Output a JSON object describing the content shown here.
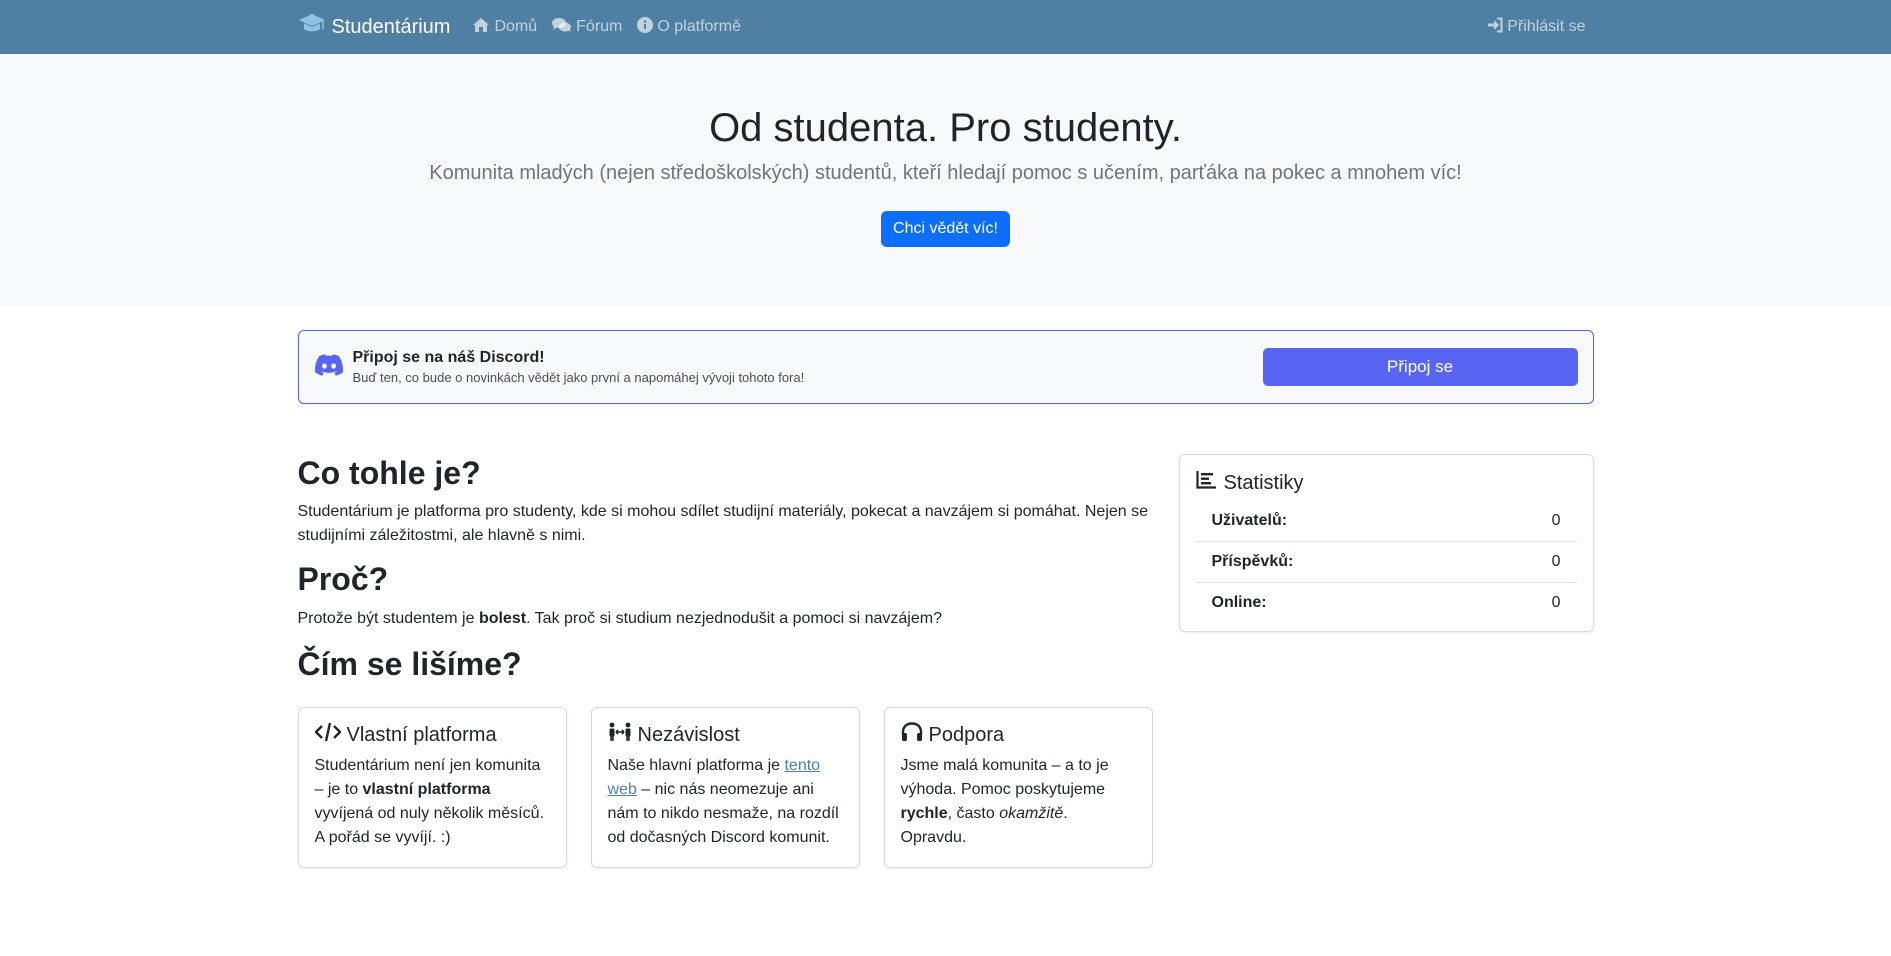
{
  "nav": {
    "brand": "Studentárium",
    "links": [
      {
        "label": "Domů",
        "icon": "home-icon"
      },
      {
        "label": "Fórum",
        "icon": "comments-icon"
      },
      {
        "label": "O platformě",
        "icon": "info-circle-icon"
      }
    ],
    "login": "Přihlásit se",
    "colors": {
      "navbar_bg": "#4f7fa3"
    }
  },
  "hero": {
    "title": "Od studenta. Pro studenty.",
    "subtitle": "Komunita mladých (nejen středoškolských) studentů, kteří hledají pomoc s učením, parťáka na pokec a mnohem víc!",
    "button": "Chci vědět víc!"
  },
  "discord": {
    "title": "Připoj se na náš Discord!",
    "subtitle": "Buď ten, co bude o novinkách vědět jako první a napomáhej vývoji tohoto fora!",
    "button": "Připoj se",
    "color": "#5865f2"
  },
  "about": {
    "heading": "Co tohle je?",
    "text": "Studentárium je platforma pro studenty, kde si mohou sdílet studijní materiály, pokecat a navzájem si pomáhat. Nejen se studijními záležitostmi, ale hlavně s nimi."
  },
  "why": {
    "heading": "Proč?",
    "text_before": "Protože být studentem je ",
    "text_bold": "bolest",
    "text_after": ". Tak proč si studium nezjednodušit a pomoci si navzájem?"
  },
  "differ": {
    "heading": "Čím se lišíme?",
    "cards": [
      {
        "title": "Vlastní platforma",
        "icon": "code-icon",
        "t1": "Studentárium není jen komunita – je to ",
        "b1": "vlastní platforma",
        "t2": " vyvíjená od nuly několik měsíců. A pořád se vyvíjí. :)"
      },
      {
        "title": "Nezávislost",
        "icon": "people-arrows-icon",
        "t1": "Naše hlavní platforma je ",
        "link": "tento web",
        "t2": " – nic nás neomezuje ani nám to nikdo nesmaže, na rozdíl od dočasných Discord komunit."
      },
      {
        "title": "Podpora",
        "icon": "headphones-icon",
        "t1": "Jsme malá komunita – a to je výhoda. Pomoc poskytujeme ",
        "b1": "rychle",
        "t2": ", často ",
        "i1": "okamžitě",
        "t3": ". Opravdu."
      }
    ]
  },
  "stats": {
    "title": "Statistiky",
    "rows": [
      {
        "label": "Uživatelů:",
        "value": "0"
      },
      {
        "label": "Příspěvků:",
        "value": "0"
      },
      {
        "label": "Online:",
        "value": "0"
      }
    ]
  }
}
